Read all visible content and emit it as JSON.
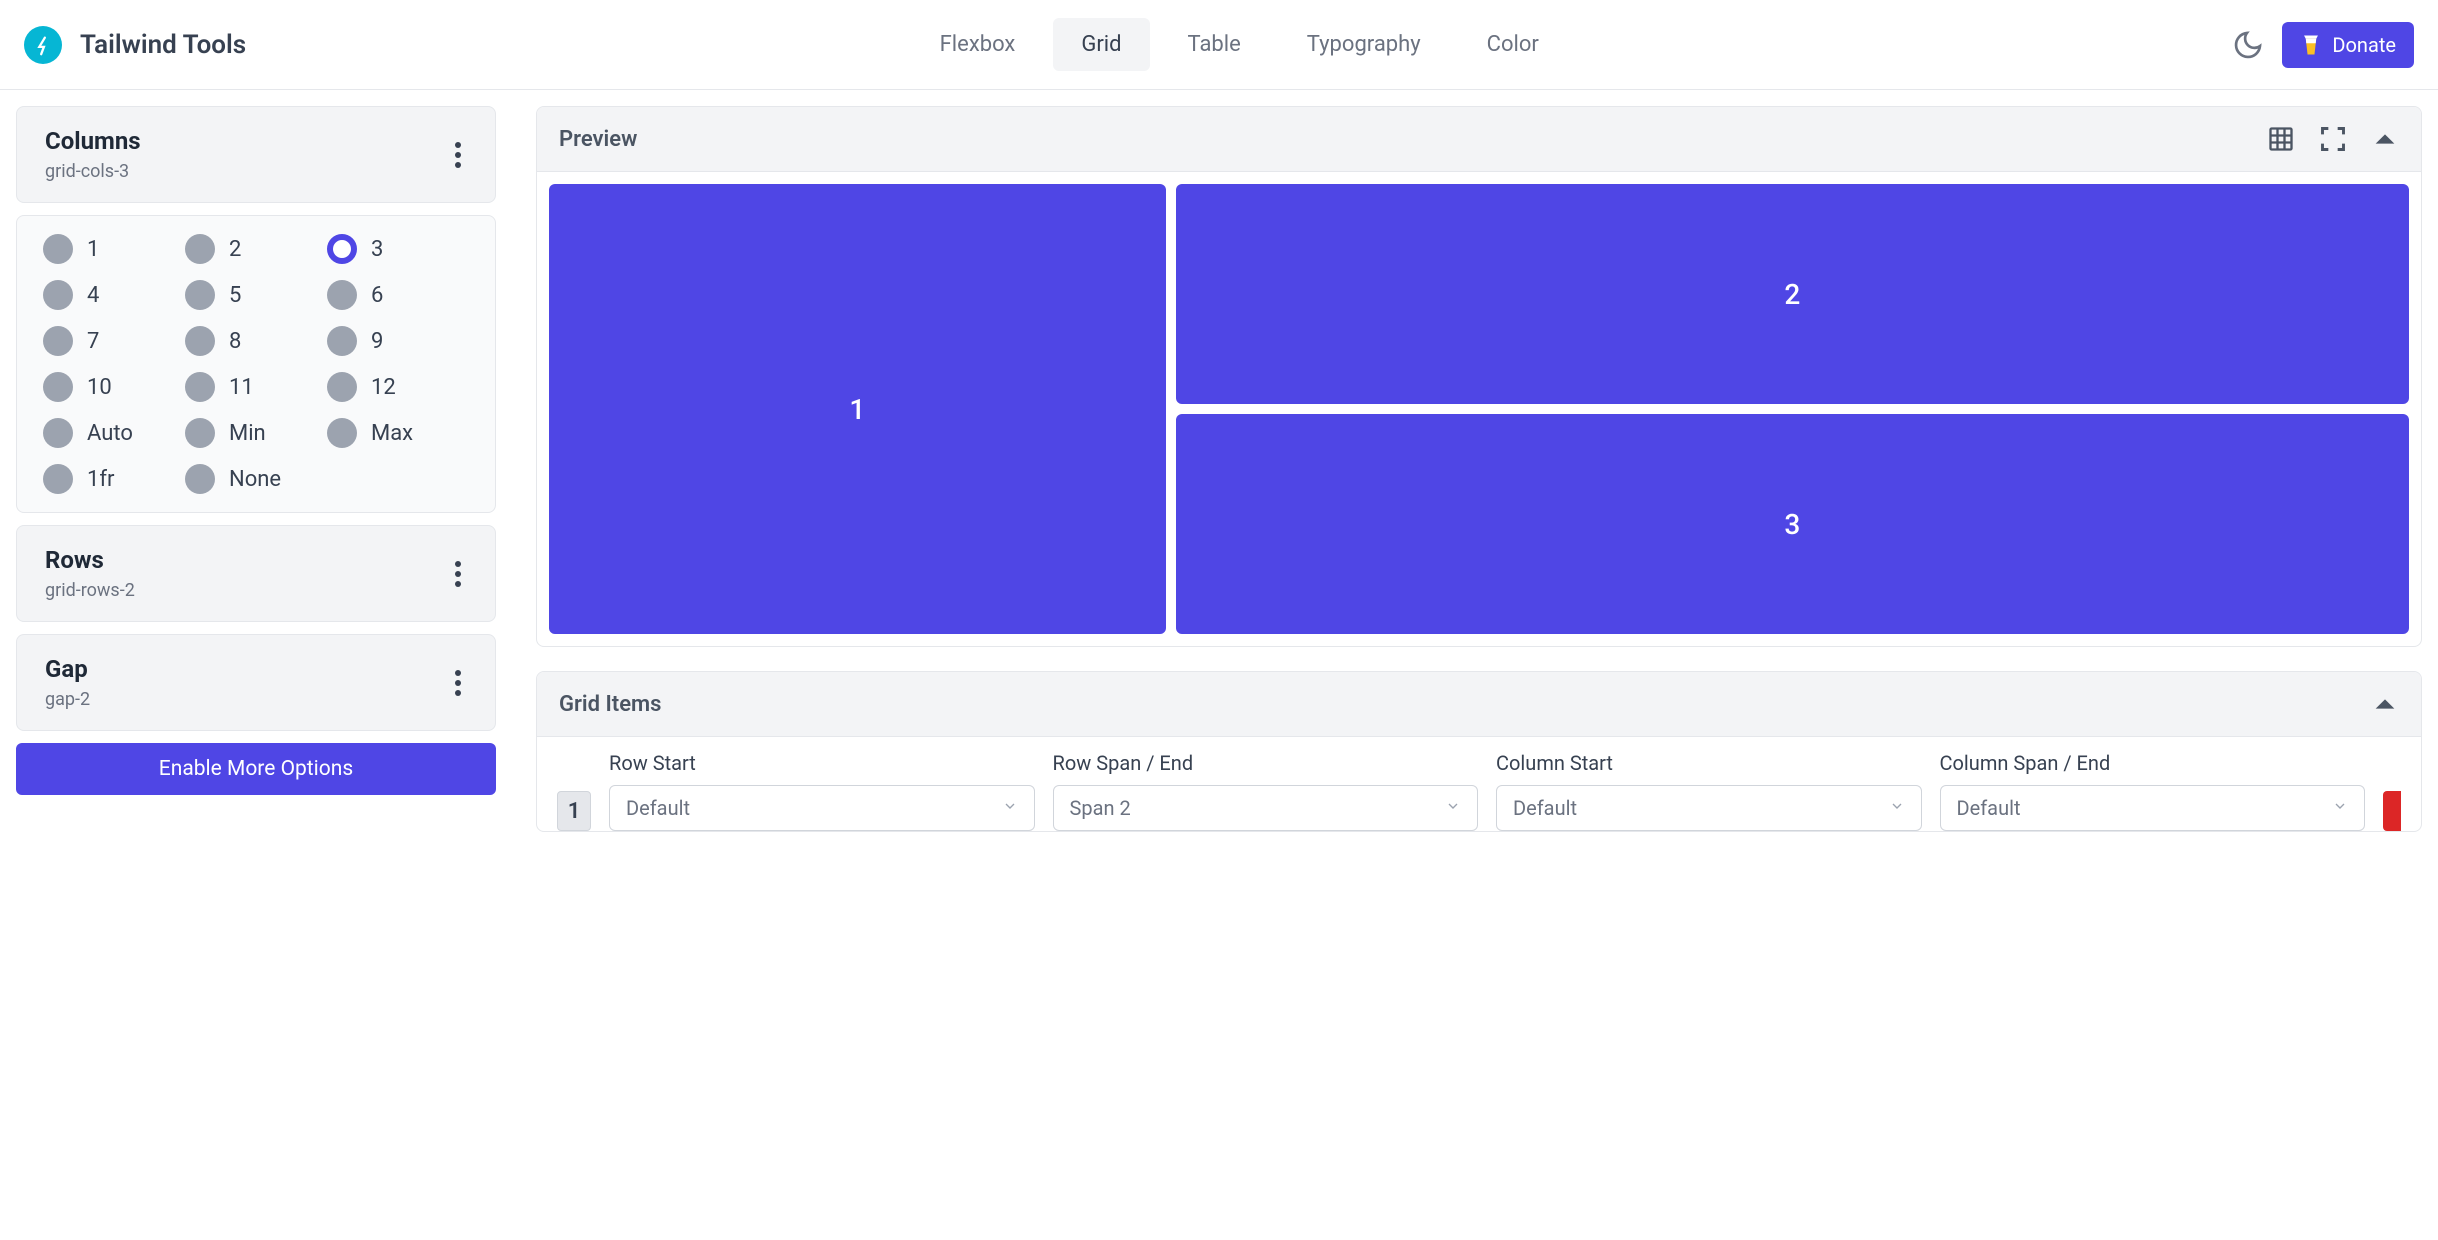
{
  "header": {
    "brand": "Tailwind Tools",
    "nav": [
      "Flexbox",
      "Grid",
      "Table",
      "Typography",
      "Color"
    ],
    "activeNav": 1,
    "donate": "Donate"
  },
  "sidebar": {
    "columns": {
      "title": "Columns",
      "subtitle": "grid-cols-3",
      "options": [
        "1",
        "2",
        "3",
        "4",
        "5",
        "6",
        "7",
        "8",
        "9",
        "10",
        "11",
        "12",
        "Auto",
        "Min",
        "Max",
        "1fr",
        "None"
      ],
      "selected": 2
    },
    "rows": {
      "title": "Rows",
      "subtitle": "grid-rows-2"
    },
    "gap": {
      "title": "Gap",
      "subtitle": "gap-2"
    },
    "enableBtn": "Enable More Options"
  },
  "preview": {
    "title": "Preview",
    "cells": [
      "1",
      "2",
      "3"
    ]
  },
  "gridItems": {
    "title": "Grid Items",
    "rowNumber": "1",
    "fields": [
      {
        "label": "Row Start",
        "value": "Default"
      },
      {
        "label": "Row Span / End",
        "value": "Span 2"
      },
      {
        "label": "Column Start",
        "value": "Default"
      },
      {
        "label": "Column Span / End",
        "value": "Default"
      }
    ]
  }
}
